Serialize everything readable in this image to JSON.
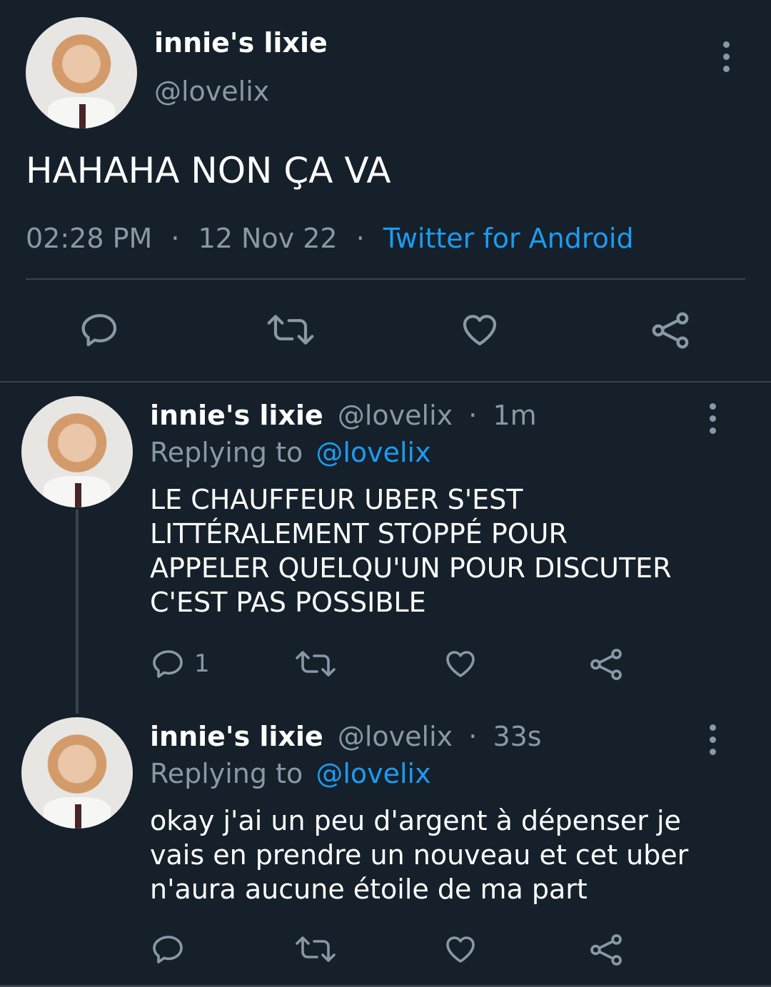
{
  "main_tweet": {
    "display_name": "innie's lixie",
    "handle": "@lovelix",
    "text": "HAHAHA NON ÇA VA",
    "time": "02:28 PM",
    "separator": "·",
    "date": "12 Nov 22",
    "source": "Twitter for Android"
  },
  "replies": [
    {
      "display_name": "innie's lixie",
      "handle": "@lovelix",
      "age": "1m",
      "separator": "·",
      "replying_label": "Replying to",
      "replying_to": "@lovelix",
      "text_lines": [
        "LE CHAUFFEUR UBER S'EST",
        "LITTÉRALEMENT STOPPÉ POUR",
        "APPELER QUELQU'UN POUR DISCUTER",
        "C'EST PAS POSSIBLE"
      ],
      "reply_count": "1"
    },
    {
      "display_name": "innie's lixie",
      "handle": "@lovelix",
      "age": "33s",
      "separator": "·",
      "replying_label": "Replying to",
      "replying_to": "@lovelix",
      "text_lines": [
        "okay j'ai un peu d'argent à dépenser je",
        "vais en prendre un nouveau et cet uber",
        "n'aura aucune étoile de ma part"
      ],
      "reply_count": ""
    }
  ],
  "colors": {
    "background": "#15202b",
    "muted": "#8899a6",
    "accent": "#1d9bf0",
    "divider": "#38444d"
  },
  "icons": [
    "reply-icon",
    "retweet-icon",
    "like-icon",
    "share-icon",
    "more-icon"
  ]
}
